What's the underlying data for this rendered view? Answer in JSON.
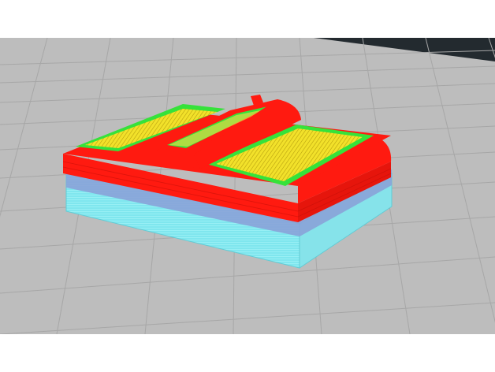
{
  "viewport": {
    "view": "3d-slicer-layer-preview",
    "background_color": "#bdbdbd",
    "grid_color": "#a7a7a7",
    "backdrop_color": "#232a2f"
  },
  "model": {
    "feature_colors": {
      "support": "#7fe6ee",
      "support_interface": "#8aa2d8",
      "outer_wall": "#ff1a10",
      "inner_wall": "#36e23a",
      "top_infill": "#f2e12a"
    }
  }
}
